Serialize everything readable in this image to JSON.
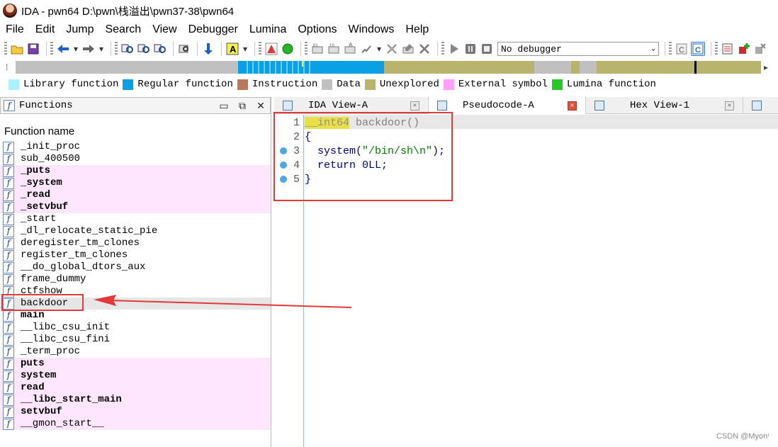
{
  "window": {
    "title": "IDA - pwn64 D:\\pwn\\栈溢出\\pwn37-38\\pwn64"
  },
  "menu": [
    "File",
    "Edit",
    "Jump",
    "Search",
    "View",
    "Debugger",
    "Lumina",
    "Options",
    "Windows",
    "Help"
  ],
  "toolbar": {
    "debugger_select": "No debugger"
  },
  "legend": [
    {
      "label": "Library function",
      "color": "#aaf0ff"
    },
    {
      "label": "Regular function",
      "color": "#0aa0e6"
    },
    {
      "label": "Instruction",
      "color": "#b8785a"
    },
    {
      "label": "Data",
      "color": "#c0c0c0"
    },
    {
      "label": "Unexplored",
      "color": "#b8b46e"
    },
    {
      "label": "External symbol",
      "color": "#ffa0ff"
    },
    {
      "label": "Lumina function",
      "color": "#28c828"
    }
  ],
  "functions_pane": {
    "title": "Functions",
    "column_header": "Function name",
    "items": [
      {
        "name": "_init_proc",
        "style": "normal"
      },
      {
        "name": "sub_400500",
        "style": "normal"
      },
      {
        "name": "_puts",
        "style": "ext"
      },
      {
        "name": "_system",
        "style": "ext"
      },
      {
        "name": "_read",
        "style": "ext"
      },
      {
        "name": "_setvbuf",
        "style": "ext"
      },
      {
        "name": "_start",
        "style": "normal"
      },
      {
        "name": "_dl_relocate_static_pie",
        "style": "normal"
      },
      {
        "name": "deregister_tm_clones",
        "style": "normal"
      },
      {
        "name": "register_tm_clones",
        "style": "normal"
      },
      {
        "name": "__do_global_dtors_aux",
        "style": "normal"
      },
      {
        "name": "frame_dummy",
        "style": "normal"
      },
      {
        "name": "ctfshow",
        "style": "normal"
      },
      {
        "name": "backdoor",
        "style": "selected"
      },
      {
        "name": "main",
        "style": "bold"
      },
      {
        "name": "__libc_csu_init",
        "style": "normal"
      },
      {
        "name": "__libc_csu_fini",
        "style": "normal"
      },
      {
        "name": "_term_proc",
        "style": "normal"
      },
      {
        "name": "puts",
        "style": "ext"
      },
      {
        "name": "system",
        "style": "ext"
      },
      {
        "name": "read",
        "style": "ext"
      },
      {
        "name": "__libc_start_main",
        "style": "ext"
      },
      {
        "name": "setvbuf",
        "style": "ext"
      },
      {
        "name": "__gmon_start__",
        "style": "ext-normal"
      }
    ]
  },
  "tabs": [
    {
      "label": "IDA View-A",
      "active": false
    },
    {
      "label": "Pseudocode-A",
      "active": true
    },
    {
      "label": "Hex View-1",
      "active": false
    }
  ],
  "pseudocode": {
    "lines": [
      {
        "num": "1",
        "type": "__int64",
        "sig": " backdoor()",
        "bp": false
      },
      {
        "num": "2",
        "text": "{",
        "bp": false
      },
      {
        "num": "3",
        "pre": "  system(",
        "str": "\"/bin/sh\\n\"",
        "post": ");",
        "bp": true
      },
      {
        "num": "4",
        "text": "  return 0LL;",
        "bp": true
      },
      {
        "num": "5",
        "text": "}",
        "bp": true
      }
    ]
  },
  "watermark": "CSDN @Myon⁽"
}
